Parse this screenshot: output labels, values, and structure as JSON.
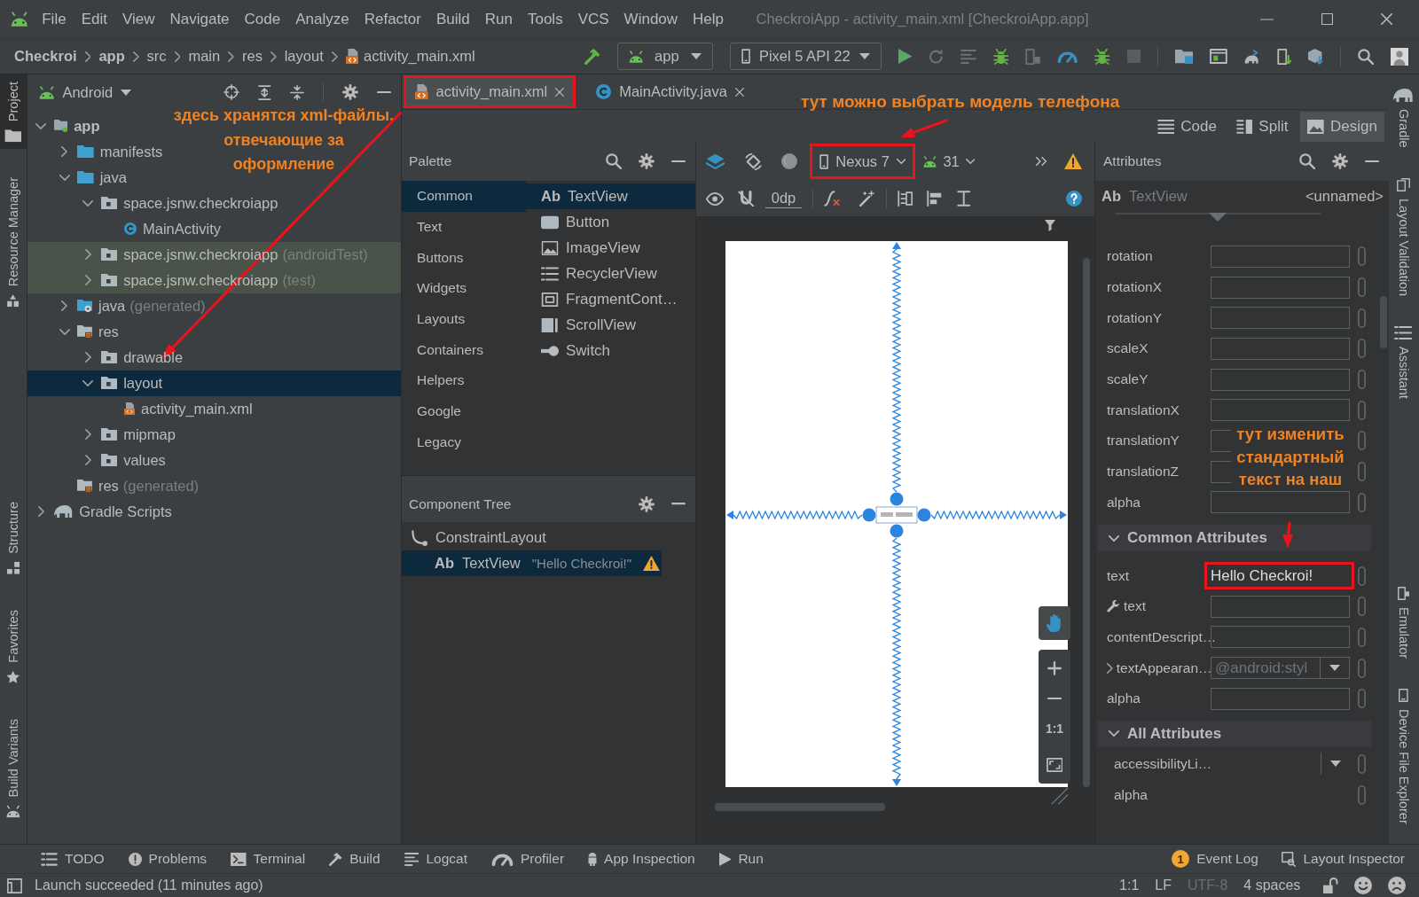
{
  "menu": {
    "items": [
      "File",
      "Edit",
      "View",
      "Navigate",
      "Code",
      "Analyze",
      "Refactor",
      "Build",
      "Run",
      "Tools",
      "VCS",
      "Window",
      "Help"
    ],
    "title": "CheckroiApp - activity_main.xml [CheckroiApp.app]"
  },
  "nav": {
    "breadcrumbs": [
      {
        "label": "Checkroi",
        "kind": "project"
      },
      {
        "label": "app",
        "kind": "module"
      },
      {
        "label": "src",
        "kind": "folder"
      },
      {
        "label": "main",
        "kind": "folder"
      },
      {
        "label": "res",
        "kind": "folder"
      },
      {
        "label": "layout",
        "kind": "folder"
      },
      {
        "label": "activity_main.xml",
        "kind": "xml"
      }
    ],
    "run_config": "app",
    "device": "Pixel 5 API 22"
  },
  "left_strip": {
    "top": [
      {
        "label": "Project",
        "kind": "folder",
        "selected": true
      },
      {
        "label": "Resource Manager",
        "kind": "resources",
        "selected": false
      }
    ],
    "bottom": [
      {
        "label": "Structure",
        "kind": "structure",
        "selected": false
      },
      {
        "label": "Favorites",
        "kind": "star",
        "selected": false
      },
      {
        "label": "Build Variants",
        "kind": "android",
        "selected": false
      }
    ]
  },
  "project": {
    "view": "Android",
    "tree": [
      {
        "label": "app",
        "kind": "module",
        "expanded": true,
        "selected": false,
        "children": [
          {
            "label": "manifests",
            "kind": "folder",
            "expanded": false,
            "selected": false
          },
          {
            "label": "java",
            "kind": "folder",
            "expanded": true,
            "selected": false,
            "children": [
              {
                "label": "space.jsnw.checkroiapp",
                "kind": "package",
                "expanded": true,
                "selected": false,
                "children": [
                  {
                    "label": "MainActivity",
                    "kind": "class",
                    "selected": false
                  }
                ]
              },
              {
                "label": "space.jsnw.checkroiapp",
                "note": "(androidTest)",
                "kind": "test-package",
                "expanded": false,
                "selected": false
              },
              {
                "label": "space.jsnw.checkroiapp",
                "note": "(test)",
                "kind": "test-package",
                "expanded": false,
                "selected": false
              }
            ]
          },
          {
            "label": "java",
            "note": "(generated)",
            "kind": "generated",
            "expanded": false,
            "selected": false
          },
          {
            "label": "res",
            "kind": "res",
            "expanded": true,
            "selected": false,
            "children": [
              {
                "label": "drawable",
                "kind": "package",
                "expanded": false,
                "selected": false
              },
              {
                "label": "layout",
                "kind": "package",
                "expanded": true,
                "selected": true,
                "children": [
                  {
                    "label": "activity_main.xml",
                    "kind": "xml",
                    "selected": false
                  }
                ]
              },
              {
                "label": "mipmap",
                "kind": "package",
                "expanded": false,
                "selected": false
              },
              {
                "label": "values",
                "kind": "package",
                "expanded": false,
                "selected": false
              }
            ]
          },
          {
            "label": "res",
            "note": "(generated)",
            "kind": "res",
            "selected": false
          }
        ]
      },
      {
        "label": "Gradle Scripts",
        "kind": "gradle",
        "expanded": false,
        "selected": false
      }
    ]
  },
  "editor_tabs": [
    {
      "label": "activity_main.xml",
      "kind": "xml",
      "selected": true,
      "highlighted": true
    },
    {
      "label": "MainActivity.java",
      "kind": "class",
      "selected": false,
      "highlighted": false
    }
  ],
  "view_modes": [
    {
      "label": "Code",
      "kind": "code",
      "selected": false
    },
    {
      "label": "Split",
      "kind": "split",
      "selected": false
    },
    {
      "label": "Design",
      "kind": "design",
      "selected": true
    }
  ],
  "palette": {
    "title": "Palette",
    "categories": [
      {
        "label": "Common",
        "selected": true
      },
      {
        "label": "Text",
        "selected": false
      },
      {
        "label": "Buttons",
        "selected": false
      },
      {
        "label": "Widgets",
        "selected": false
      },
      {
        "label": "Layouts",
        "selected": false
      },
      {
        "label": "Containers",
        "selected": false
      },
      {
        "label": "Helpers",
        "selected": false
      },
      {
        "label": "Google",
        "selected": false
      },
      {
        "label": "Legacy",
        "selected": false
      }
    ],
    "items": [
      {
        "label": "TextView",
        "kind": "text",
        "glyph": "Ab",
        "selected": true
      },
      {
        "label": "Button",
        "kind": "button",
        "selected": false
      },
      {
        "label": "ImageView",
        "kind": "image",
        "selected": false
      },
      {
        "label": "RecyclerView",
        "kind": "list",
        "selected": false
      },
      {
        "label": "FragmentCont…",
        "kind": "fragment",
        "selected": false
      },
      {
        "label": "ScrollView",
        "kind": "scroll",
        "selected": false
      },
      {
        "label": "Switch",
        "kind": "switch",
        "selected": false
      }
    ]
  },
  "component_tree": {
    "title": "Component Tree",
    "items": [
      {
        "label": "ConstraintLayout",
        "kind": "layout",
        "selected": false,
        "warning": false,
        "children": [
          {
            "label": "TextView",
            "kind": "text",
            "glyph": "Ab",
            "hint": "\"Hello Checkroi!\"",
            "selected": true,
            "warning": true
          }
        ]
      }
    ]
  },
  "design_toolbar": {
    "device": {
      "label": "Nexus 7",
      "highlighted": true
    },
    "api": "31",
    "margin": "0dp"
  },
  "canvas": {
    "zoom_reset": "1:1"
  },
  "attributes": {
    "title": "Attributes",
    "component": {
      "glyph": "Ab",
      "type": "TextView",
      "id": "<unnamed>"
    },
    "transforms": [
      "rotation",
      "rotationX",
      "rotationY",
      "scaleX",
      "scaleY",
      "translationX",
      "translationY",
      "translationZ",
      "alpha"
    ],
    "common": {
      "title": "Common Attributes",
      "expanded": true,
      "rows": [
        {
          "label": "text",
          "kind": "field",
          "value": "Hello Checkroi!",
          "highlighted": true
        },
        {
          "label": "text",
          "kind": "tools-field",
          "highlighted": false
        },
        {
          "label": "contentDescript…",
          "kind": "field",
          "highlighted": false
        },
        {
          "label": "textAppearan…",
          "kind": "group-dropdown",
          "value": "@android:styl",
          "highlighted": false
        },
        {
          "label": "alpha",
          "kind": "field",
          "highlighted": false
        }
      ]
    },
    "all": {
      "title": "All Attributes",
      "expanded": true,
      "rows": [
        {
          "label": "accessibilityLi…",
          "kind": "dropdown"
        },
        {
          "label": "alpha",
          "kind": "plain"
        }
      ]
    }
  },
  "right_strip": {
    "top": [
      {
        "label": "Gradle",
        "kind": "gradle"
      },
      {
        "label": "Layout Validation",
        "kind": "validation"
      },
      {
        "label": "Assistant",
        "kind": "assistant"
      }
    ],
    "bottom": [
      {
        "label": "Emulator",
        "kind": "emulator"
      },
      {
        "label": "Device File Explorer",
        "kind": "device"
      }
    ]
  },
  "bottom_tools": {
    "left": [
      {
        "label": "TODO",
        "kind": "todo"
      },
      {
        "label": "Problems",
        "kind": "problems"
      },
      {
        "label": "Terminal",
        "kind": "terminal"
      },
      {
        "label": "Build",
        "kind": "build"
      },
      {
        "label": "Logcat",
        "kind": "logcat"
      },
      {
        "label": "Profiler",
        "kind": "profiler"
      },
      {
        "label": "App Inspection",
        "kind": "inspection"
      },
      {
        "label": "Run",
        "kind": "run"
      }
    ],
    "right": [
      {
        "label": "Event Log",
        "kind": "event-log",
        "badge": "1"
      },
      {
        "label": "Layout Inspector",
        "kind": "layout-inspector"
      }
    ]
  },
  "status": {
    "message": "Launch succeeded (11 minutes ago)",
    "items": [
      {
        "label": "1:1",
        "disabled": false
      },
      {
        "label": "LF",
        "disabled": false
      },
      {
        "label": "UTF-8",
        "disabled": true
      },
      {
        "label": "4 spaces",
        "disabled": false
      }
    ]
  },
  "annotations": [
    {
      "kind": "tree-note",
      "lines": [
        "здесь хранятся xml-файлы,",
        "отвечающие за",
        "оформление"
      ]
    },
    {
      "kind": "device-note",
      "lines": [
        "тут можно выбрать модель телефона"
      ]
    },
    {
      "kind": "text-note",
      "lines": [
        "тут изменить",
        "стандартный",
        "текст на наш"
      ]
    }
  ]
}
